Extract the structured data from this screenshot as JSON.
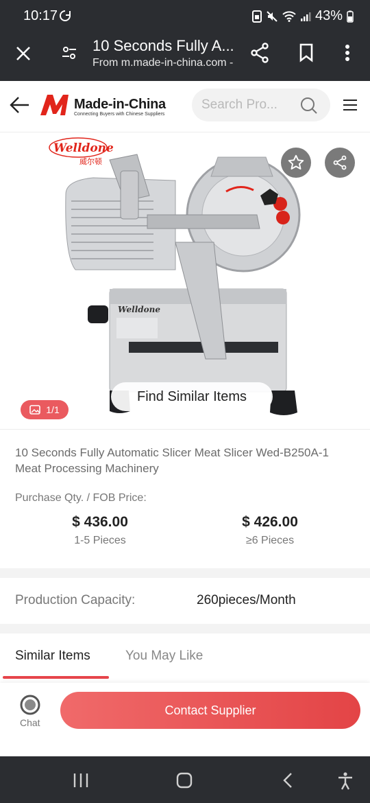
{
  "status_bar": {
    "time": "10:17",
    "battery": "43%"
  },
  "browser": {
    "page_title": "10 Seconds Fully A...",
    "source_url": "From m.made-in-china.com -"
  },
  "site": {
    "logo_name": "Made-in-China",
    "logo_tagline": "Connecting Buyers with Chinese Suppliers",
    "search_placeholder": "Search Pro..."
  },
  "gallery": {
    "brand_logo_text": "Welldone",
    "counter": "1/1",
    "find_similar_label": "Find Similar Items"
  },
  "product": {
    "title": "10 Seconds Fully Automatic Slicer Meat Slicer Wed-B250A-1 Meat Processing Machinery",
    "price_label": "Purchase Qty. / FOB Price:",
    "prices": [
      {
        "price": "$ 436.00",
        "qty": "1-5 Pieces"
      },
      {
        "price": "$ 426.00",
        "qty": "≥6 Pieces"
      }
    ],
    "capacity_label": "Production Capacity:",
    "capacity_value": "260pieces/Month"
  },
  "tabs": [
    {
      "label": "Similar Items",
      "active": true
    },
    {
      "label": "You May Like",
      "active": false
    }
  ],
  "bottom_bar": {
    "chat_label": "Chat",
    "contact_label": "Contact Supplier"
  },
  "colors": {
    "accent": "#e6454b",
    "dark_bar": "#2b2d31"
  },
  "icons": [
    "close-icon",
    "tune-icon",
    "share-icon",
    "bookmark-icon",
    "more-vert-icon",
    "back-arrow-icon",
    "search-icon",
    "menu-icon",
    "star-icon",
    "image-icon",
    "chat-icon",
    "recents-icon",
    "home-icon",
    "nav-back-icon",
    "accessibility-icon"
  ]
}
